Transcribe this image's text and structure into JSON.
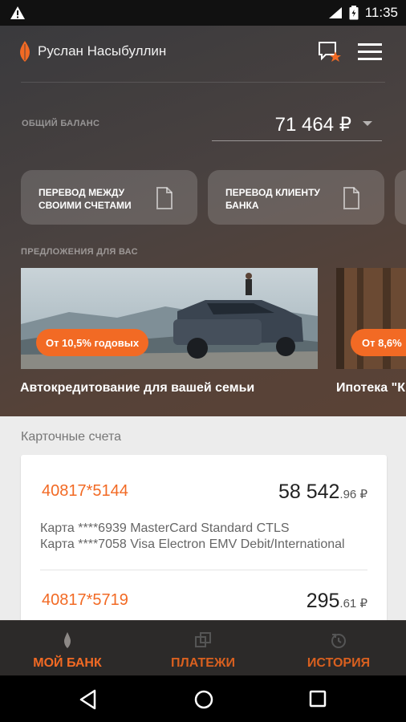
{
  "status_bar": {
    "time": "11:35"
  },
  "header": {
    "user_name": "Руслан Насыбуллин"
  },
  "balance": {
    "label": "ОБЩИЙ БАЛАНС",
    "value": "71 464 ₽"
  },
  "quick_actions": [
    {
      "line1": "ПЕРЕВОД МЕЖДУ",
      "line2": "СВОИМИ СЧЕТАМИ"
    },
    {
      "line1": "ПЕРЕВОД КЛИЕНТУ",
      "line2": "БАНКА"
    }
  ],
  "offers": {
    "label": "ПРЕДЛОЖЕНИЯ ДЛЯ ВАС",
    "items": [
      {
        "badge": "От 10,5% годовых",
        "title": "Автокредитование для вашей семьи"
      },
      {
        "badge": "От 8,6%",
        "title": "Ипотека \"К"
      }
    ]
  },
  "accounts": {
    "section_title": "Карточные счета",
    "items": [
      {
        "number": "40817*5144",
        "amount_int": "58 542",
        "amount_dec": ".96 ₽",
        "cards": [
          "Карта ****6939 MasterCard Standard CTLS",
          "Карта ****7058 Visa Electron EMV Debit/International"
        ]
      },
      {
        "number": "40817*5719",
        "amount_int": "295",
        "amount_dec": ".61 ₽"
      }
    ]
  },
  "bottom_nav": [
    {
      "label": "МОЙ БАНК",
      "icon": "bank-icon",
      "active": true
    },
    {
      "label": "ПЛАТЕЖИ",
      "icon": "payments-icon",
      "active": false
    },
    {
      "label": "ИСТОРИЯ",
      "icon": "history-icon",
      "active": false
    }
  ],
  "colors": {
    "accent": "#f26a24",
    "nav_bg": "#2c2a29",
    "list_bg": "#ececec"
  }
}
